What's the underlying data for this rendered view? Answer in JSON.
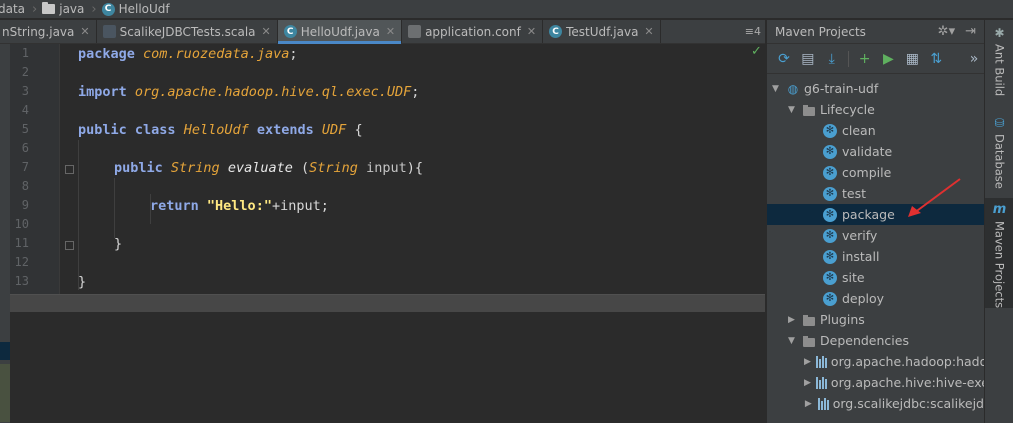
{
  "breadcrumb": {
    "items": [
      "data",
      "java",
      "HelloUdf"
    ]
  },
  "tabs": [
    {
      "label": "nString.java",
      "icon": "java-class-icon",
      "active": false
    },
    {
      "label": "ScalikeJDBCTests.scala",
      "icon": "scala-file-icon",
      "active": false
    },
    {
      "label": "HelloUdf.java",
      "icon": "java-class-icon",
      "active": true
    },
    {
      "label": "application.conf",
      "icon": "config-file-icon",
      "active": false
    },
    {
      "label": "TestUdf.java",
      "icon": "java-class-icon",
      "active": false
    }
  ],
  "tab_overflow": "4",
  "editor": {
    "line_numbers": [
      "1",
      "2",
      "3",
      "4",
      "5",
      "6",
      "7",
      "8",
      "9",
      "10",
      "11",
      "12",
      "13"
    ],
    "code": {
      "package_kw": "package",
      "package_name": "com.ruozedata.java",
      "import_kw": "import",
      "import_name": "org.apache.hadoop.hive.ql.exec.UDF",
      "public_kw": "public",
      "class_kw": "class",
      "class_name": "HelloUdf",
      "extends_kw": "extends",
      "super_name": "UDF",
      "method_type": "String",
      "method_name": "evaluate",
      "param_type": "String",
      "param_name": "input",
      "return_kw": "return",
      "string_literal": "\"Hello:\"",
      "return_tail": "+input;"
    }
  },
  "maven": {
    "title": "Maven Projects",
    "toolbar_icons": [
      "reimport-icon",
      "add-folder-icon",
      "download-icon",
      "add-icon",
      "run-icon",
      "execute-goal-icon",
      "toggle-offline-icon",
      "more-icon"
    ],
    "project": "g6-train-udf",
    "lifecycle_label": "Lifecycle",
    "lifecycle_goals": [
      "clean",
      "validate",
      "compile",
      "test",
      "package",
      "verify",
      "install",
      "site",
      "deploy"
    ],
    "selected_goal": "package",
    "plugins_label": "Plugins",
    "dependencies_label": "Dependencies",
    "dependencies": [
      "org.apache.hadoop:hado",
      "org.apache.hive:hive-exe",
      "org.scalikejdbc:scalikejd"
    ]
  },
  "tool_stripe": {
    "ant_build": "Ant Build",
    "database": "Database",
    "maven_projects": "Maven Projects"
  },
  "colors": {
    "background": "#2b2b2b",
    "panel": "#3c3f41",
    "selection": "#0d293e",
    "accent_blue": "#4a9fd0",
    "keyword": "#8fa9e7",
    "type_italic": "#e5a43a",
    "string": "#ffe882",
    "annotation_red": "#e03030"
  }
}
